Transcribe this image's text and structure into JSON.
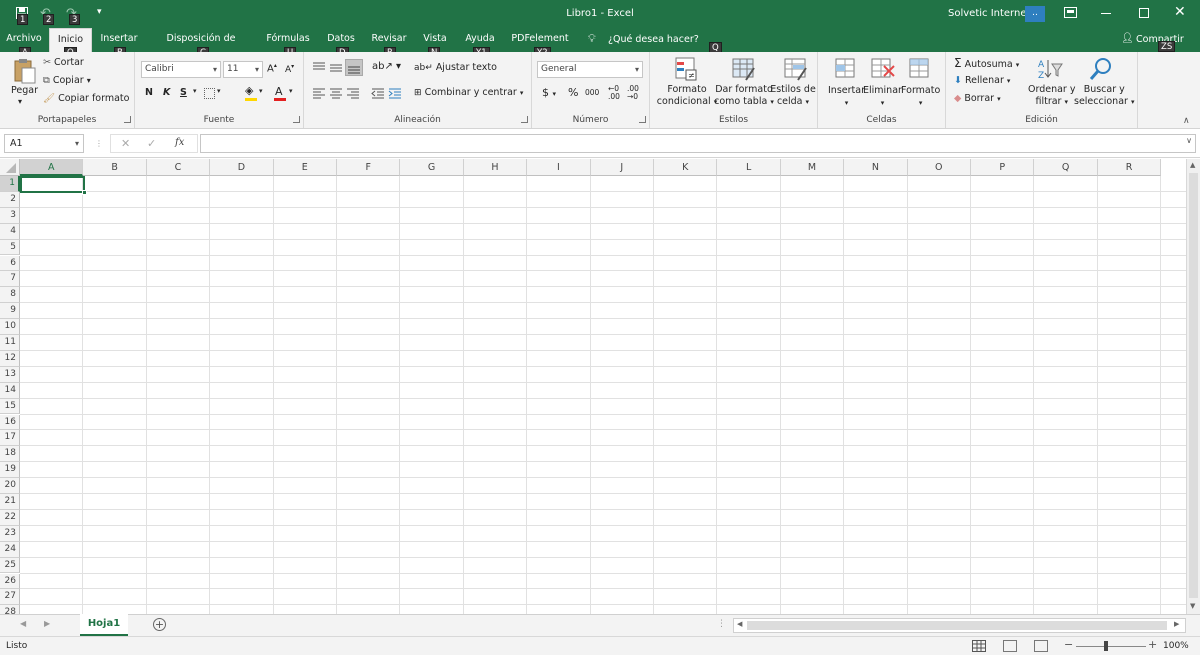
{
  "titlebar": {
    "title": "Libro1  -  Excel",
    "account": "Solvetic Internet",
    "account_badge": "..",
    "qat_keytip_save": "1",
    "qat_keytip_undo": "2",
    "qat_keytip_redo": "3",
    "accent": "#217346"
  },
  "tabs": [
    {
      "label": "Archivo",
      "keytip": "A"
    },
    {
      "label": "Inicio",
      "keytip": "O"
    },
    {
      "label": "Insertar",
      "keytip": "B"
    },
    {
      "label": "Disposición de página",
      "keytip": "C"
    },
    {
      "label": "Fórmulas",
      "keytip": "U"
    },
    {
      "label": "Datos",
      "keytip": "D"
    },
    {
      "label": "Revisar",
      "keytip": "R"
    },
    {
      "label": "Vista",
      "keytip": "N"
    },
    {
      "label": "Ayuda",
      "keytip": "Y1"
    },
    {
      "label": "PDFelement",
      "keytip": "Y2"
    }
  ],
  "tell_me": {
    "label": "¿Qué desea hacer?",
    "keytip": "Q"
  },
  "share": {
    "label": "Compartir",
    "keytip": "ZS"
  },
  "ribbon": {
    "clipboard": {
      "paste": "Pegar",
      "cut": "Cortar",
      "copy": "Copiar",
      "format_painter": "Copiar formato",
      "label": "Portapapeles"
    },
    "font": {
      "name": "Calibri",
      "size": "11",
      "bold": "N",
      "italic": "K",
      "underline": "S",
      "label": "Fuente"
    },
    "alignment": {
      "wrap": "Ajustar texto",
      "merge": "Combinar y centrar",
      "label": "Alineación"
    },
    "number": {
      "format": "General",
      "currency": "$",
      "percent": "%",
      "thousands": "000",
      "label": "Número"
    },
    "styles": {
      "conditional": [
        "Formato",
        "condicional"
      ],
      "table": [
        "Dar formato",
        "como tabla"
      ],
      "cell": [
        "Estilos de",
        "celda"
      ],
      "label": "Estilos"
    },
    "cells": {
      "insert": "Insertar",
      "delete": "Eliminar",
      "format": "Formato",
      "label": "Celdas"
    },
    "editing": {
      "autosum": "Autosuma",
      "fill": "Rellenar",
      "clear": "Borrar",
      "sort": [
        "Ordenar y",
        "filtrar"
      ],
      "find": [
        "Buscar y",
        "seleccionar"
      ],
      "label": "Edición"
    }
  },
  "formula_bar": {
    "name_box": "A1",
    "fx": "fx",
    "value": ""
  },
  "grid": {
    "columns": [
      "A",
      "B",
      "C",
      "D",
      "E",
      "F",
      "G",
      "H",
      "I",
      "J",
      "K",
      "L",
      "M",
      "N",
      "O",
      "P",
      "Q",
      "R"
    ],
    "rows": [
      "1",
      "2",
      "3",
      "4",
      "5",
      "6",
      "7",
      "8",
      "9",
      "10",
      "11",
      "12",
      "13",
      "14",
      "15",
      "16",
      "17",
      "18",
      "19",
      "20",
      "21",
      "22",
      "23",
      "24",
      "25",
      "26",
      "27",
      "28"
    ],
    "selected_cell": "A1"
  },
  "sheets": [
    {
      "name": "Hoja1",
      "active": true
    }
  ],
  "status": {
    "mode": "Listo",
    "zoom": "100%"
  }
}
